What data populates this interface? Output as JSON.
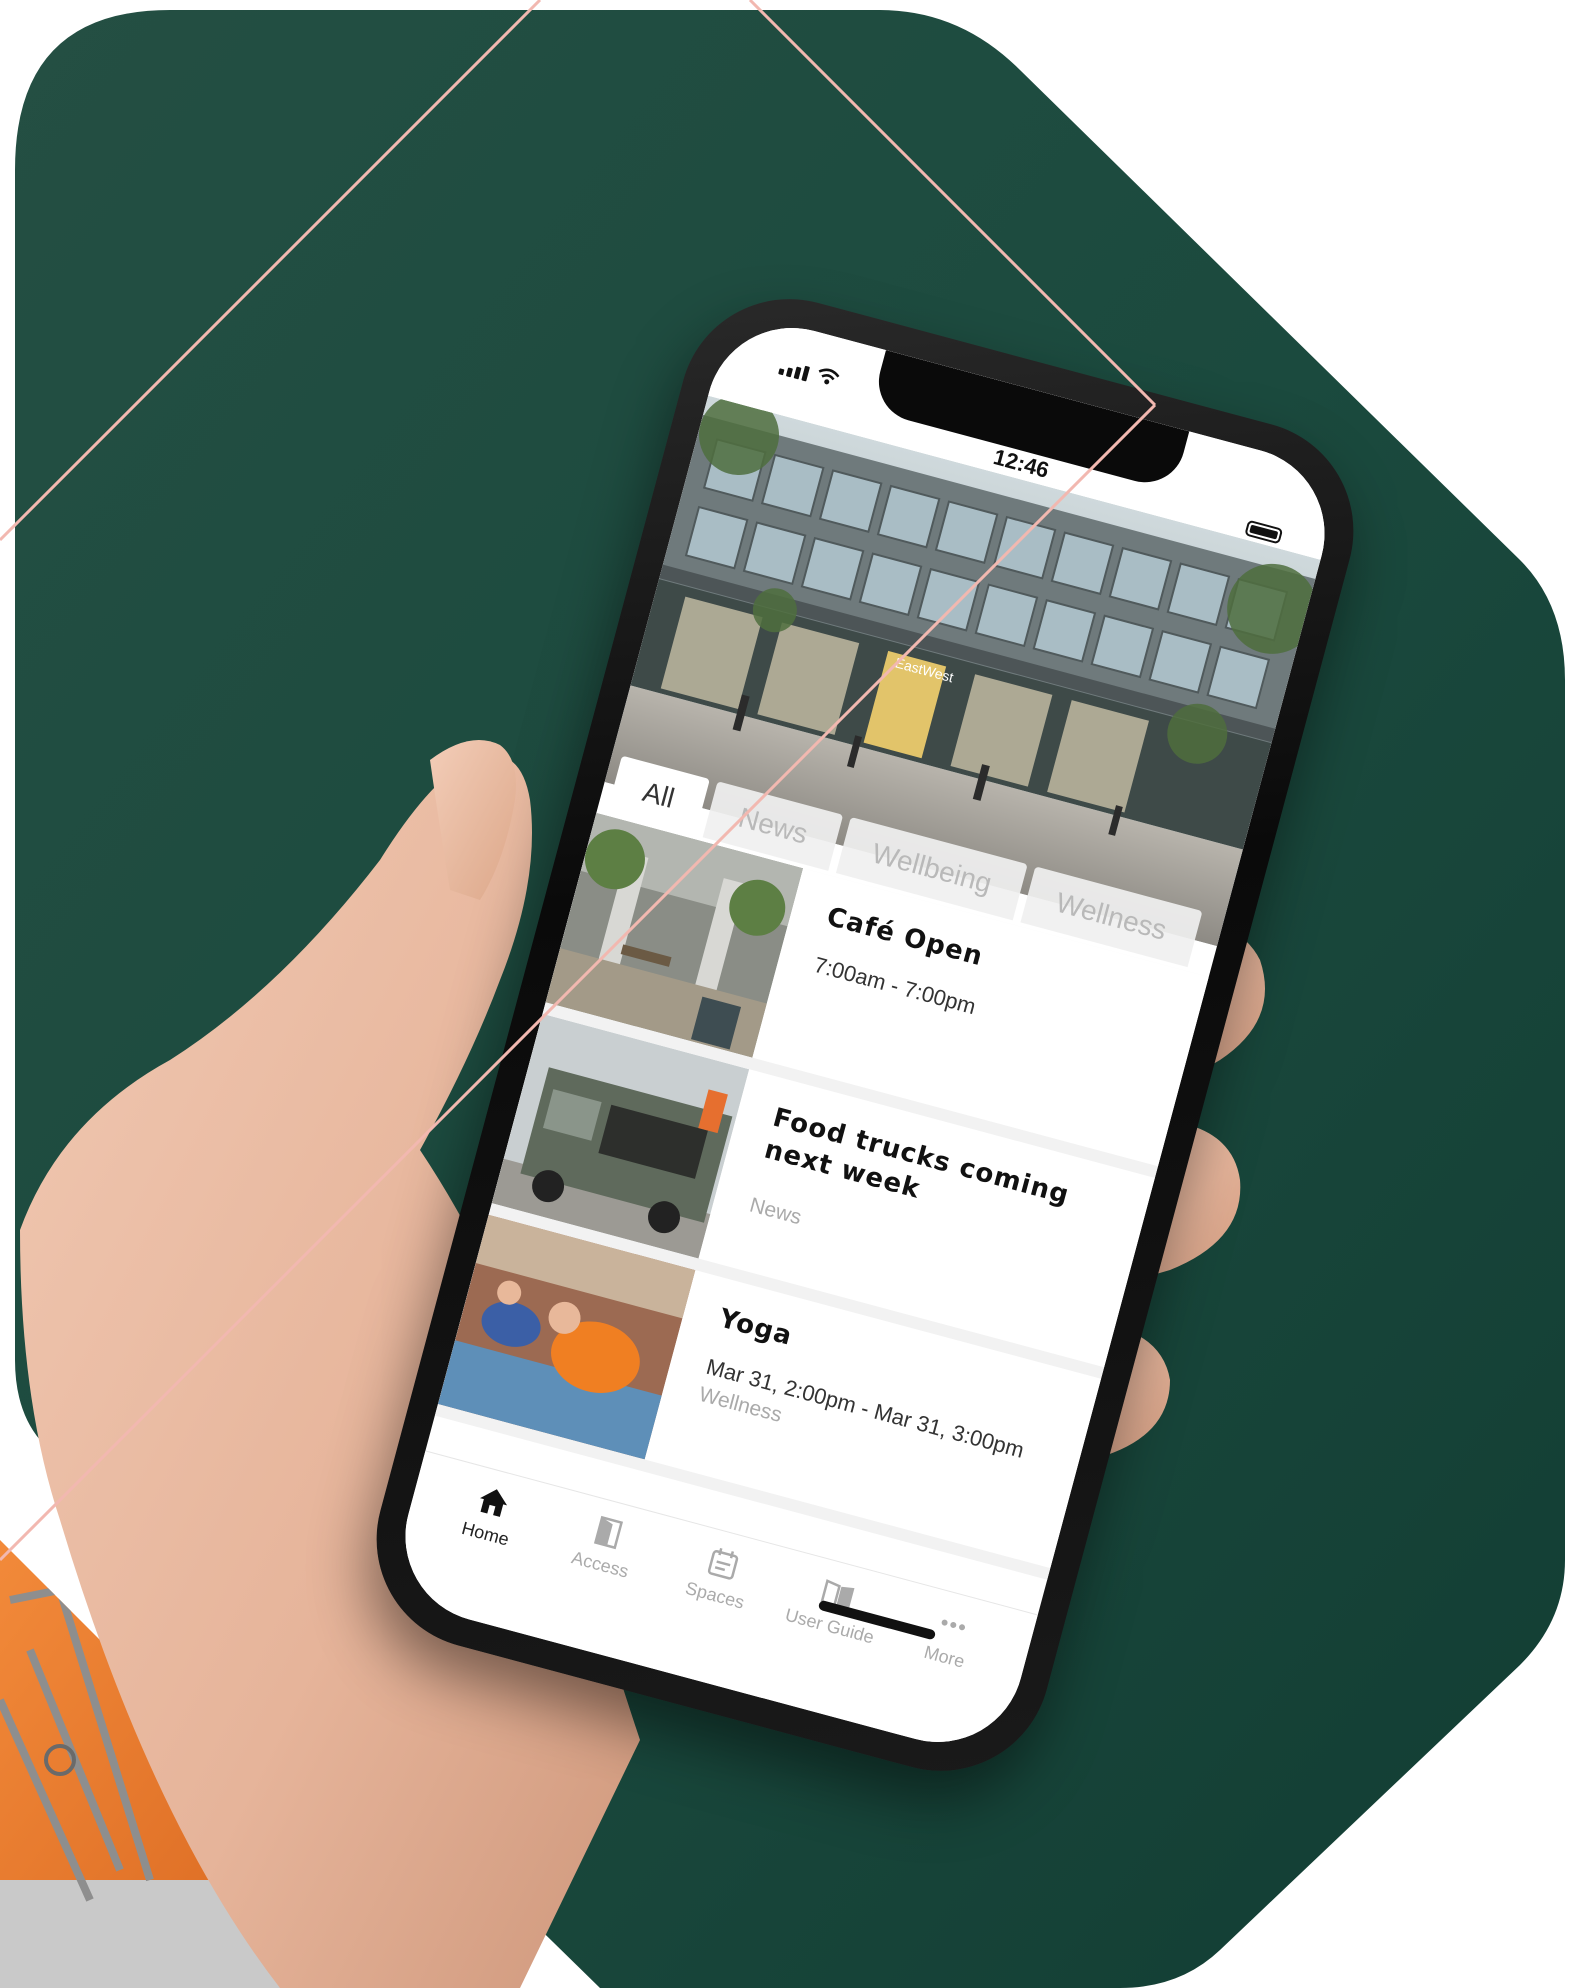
{
  "colors": {
    "background_green": "#1b4a3e",
    "accent_line": "#f2b8b0",
    "orange": "#e7772e"
  },
  "status_bar": {
    "time": "12:46"
  },
  "hero": {
    "building_sign": "EastWest"
  },
  "filter_tabs": [
    {
      "label": "All",
      "active": true
    },
    {
      "label": "News",
      "active": false
    },
    {
      "label": "Wellbeing",
      "active": false
    },
    {
      "label": "Wellness",
      "active": false
    }
  ],
  "feed": [
    {
      "title": "Café Open",
      "subtitle": "7:00am - 7:00pm",
      "tag": "",
      "image": "cafe-photo"
    },
    {
      "title": "Food trucks coming next week",
      "subtitle": "",
      "tag": "News",
      "image": "food-truck-photo"
    },
    {
      "title": "Yoga",
      "subtitle": "Mar 31, 2:00pm - Mar 31, 3:00pm",
      "tag": "Wellness",
      "image": "yoga-photo"
    }
  ],
  "tab_bar": [
    {
      "label": "Home",
      "icon": "home-icon",
      "active": true
    },
    {
      "label": "Access",
      "icon": "door-icon",
      "active": false
    },
    {
      "label": "Spaces",
      "icon": "calendar-icon",
      "active": false
    },
    {
      "label": "User Guide",
      "icon": "book-icon",
      "active": false
    },
    {
      "label": "More",
      "icon": "more-icon",
      "active": false
    }
  ]
}
